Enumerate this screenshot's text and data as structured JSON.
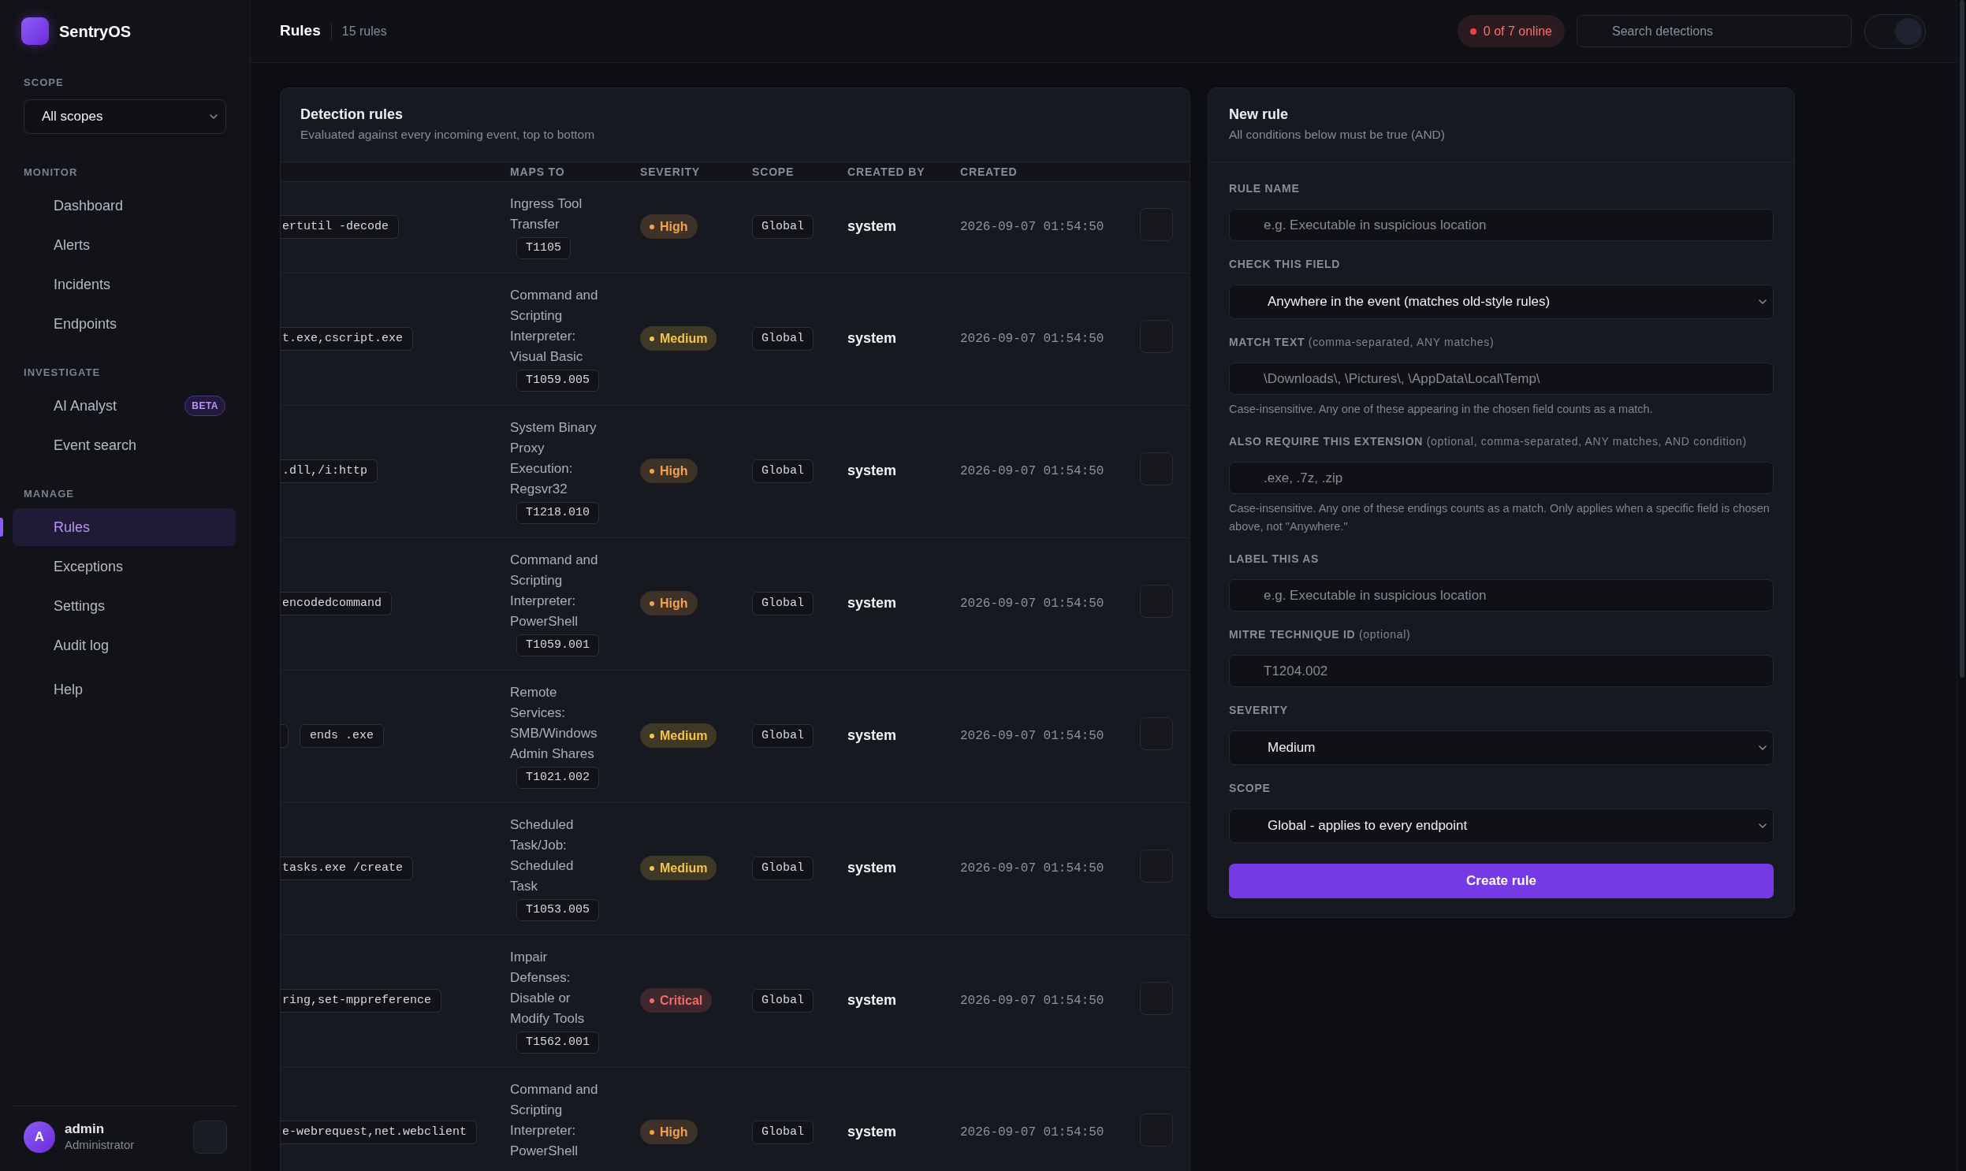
{
  "sidebar": {
    "brand": "SentryOS",
    "scope": {
      "label": "SCOPE",
      "value": "All scopes"
    },
    "sections": [
      {
        "title": "MONITOR",
        "items": [
          {
            "label": "Dashboard",
            "selected": false
          },
          {
            "label": "Alerts",
            "selected": false
          },
          {
            "label": "Incidents",
            "selected": false
          },
          {
            "label": "Endpoints",
            "selected": false
          }
        ]
      },
      {
        "title": "INVESTIGATE",
        "items": [
          {
            "label": "AI Analyst",
            "selected": false,
            "badge": "BETA"
          },
          {
            "label": "Event search",
            "selected": false
          }
        ]
      },
      {
        "title": "MANAGE",
        "items": [
          {
            "label": "Rules",
            "selected": true
          },
          {
            "label": "Exceptions",
            "selected": false
          },
          {
            "label": "Settings",
            "selected": false
          },
          {
            "label": "Audit log",
            "selected": false
          }
        ]
      },
      {
        "items": [
          {
            "label": "Help",
            "selected": false
          }
        ]
      }
    ],
    "user": {
      "initial": "A",
      "name": "admin",
      "role": "Administrator"
    }
  },
  "topbar": {
    "title": "Rules",
    "count": "15 rules",
    "status": "0 of 7 online",
    "search": {
      "placeholder": "Search detections"
    },
    "toggle": {
      "on": true
    }
  },
  "rules_card": {
    "title": "Detection rules",
    "subtitle": "Evaluated against every incoming event, top to bottom",
    "columns": [
      "MAPS TO",
      "SEVERITY",
      "SCOPE",
      "CREATED BY",
      "CREATED"
    ],
    "rows": [
      {
        "match": [
          "ertutil -decode"
        ],
        "maps_to": "Ingress Tool Transfer",
        "technique": "T1105",
        "severity": {
          "label": "High",
          "color": "#f5a04a"
        },
        "scope": "Global",
        "created_by": "system",
        "created": "2026-09-07 01:54:50"
      },
      {
        "match": [
          "t.exe,cscript.exe"
        ],
        "maps_to": "Command and Scripting Interpreter: Visual Basic",
        "technique": "T1059.005",
        "severity": {
          "label": "Medium",
          "color": "#f4c54a"
        },
        "scope": "Global",
        "created_by": "system",
        "created": "2026-09-07 01:54:50"
      },
      {
        "match": [
          ".dll,/i:http"
        ],
        "maps_to": "System Binary Proxy Execution: Regsvr32",
        "technique": "T1218.010",
        "severity": {
          "label": "High",
          "color": "#f5a04a"
        },
        "scope": "Global",
        "created_by": "system",
        "created": "2026-09-07 01:54:50"
      },
      {
        "match": [
          "encodedcommand"
        ],
        "maps_to": "Command and Scripting Interpreter: PowerShell",
        "technique": "T1059.001",
        "severity": {
          "label": "High",
          "color": "#f5a04a"
        },
        "scope": "Global",
        "created_by": "system",
        "created": "2026-09-07 01:54:50"
      },
      {
        "partial_chip": true,
        "match": [
          "ends .exe"
        ],
        "maps_to": "Remote Services: SMB/Windows Admin Shares",
        "technique": "T1021.002",
        "severity": {
          "label": "Medium",
          "color": "#f4c54a"
        },
        "scope": "Global",
        "created_by": "system",
        "created": "2026-09-07 01:54:50"
      },
      {
        "match": [
          "tasks.exe /create"
        ],
        "maps_to": "Scheduled Task/Job: Scheduled Task",
        "technique": "T1053.005",
        "severity": {
          "label": "Medium",
          "color": "#f4c54a"
        },
        "scope": "Global",
        "created_by": "system",
        "created": "2026-09-07 01:54:50"
      },
      {
        "match": [
          "ring,set-mppreference"
        ],
        "maps_to": "Impair Defenses: Disable or Modify Tools",
        "technique": "T1562.001",
        "severity": {
          "label": "Critical",
          "color": "#f26b6b"
        },
        "scope": "Global",
        "created_by": "system",
        "created": "2026-09-07 01:54:50"
      },
      {
        "match": [
          "e-webrequest,net.webclient"
        ],
        "maps_to": "Command and Scripting Interpreter: PowerShell",
        "severity": {
          "label": "High",
          "color": "#f5a04a"
        },
        "scope": "Global",
        "created_by": "system",
        "created": "2026-09-07 01:54:50"
      }
    ]
  },
  "new_rule": {
    "title": "New rule",
    "subtitle": "All conditions below must be true (AND)",
    "fields": [
      {
        "kind": "input",
        "label": "RULE NAME",
        "placeholder": "e.g. Executable in suspicious location"
      },
      {
        "kind": "select",
        "label": "CHECK THIS FIELD",
        "value": "Anywhere in the event (matches old-style rules)"
      },
      {
        "kind": "input",
        "label": "MATCH TEXT",
        "note": "(comma-separated, ANY matches)",
        "placeholder": "\\Downloads\\, \\Pictures\\, \\AppData\\Local\\Temp\\",
        "hint": "Case-insensitive. Any one of these appearing in the chosen field counts as a match."
      },
      {
        "kind": "input",
        "label": "ALSO REQUIRE THIS EXTENSION",
        "note": "(optional, comma-separated, ANY matches, AND condition)",
        "placeholder": ".exe, .7z, .zip",
        "hint": "Case-insensitive. Any one of these endings counts as a match. Only applies when a specific field is chosen above, not \"Anywhere.\""
      },
      {
        "kind": "input",
        "label": "LABEL THIS AS",
        "placeholder": "e.g. Executable in suspicious location"
      },
      {
        "kind": "input",
        "label": "MITRE TECHNIQUE ID",
        "note": "(optional)",
        "placeholder": "T1204.002"
      },
      {
        "kind": "select",
        "label": "SEVERITY",
        "value": "Medium"
      },
      {
        "kind": "select",
        "label": "SCOPE",
        "value": "Global - applies to every endpoint"
      }
    ],
    "submit": "Create rule"
  }
}
